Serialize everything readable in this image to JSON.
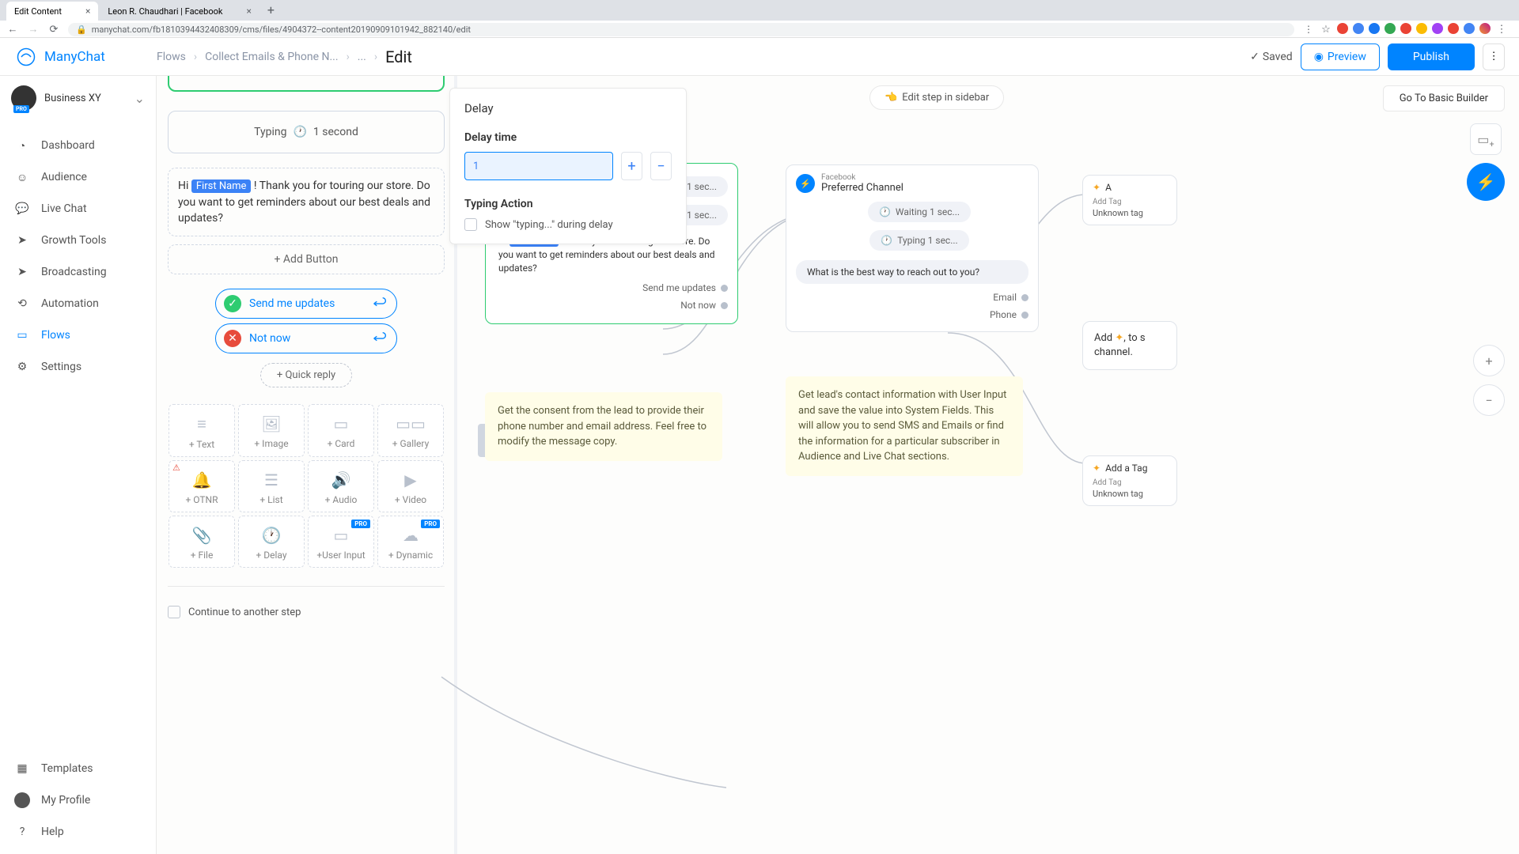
{
  "browser": {
    "tabs": [
      {
        "title": "Edit Content"
      },
      {
        "title": "Leon R. Chaudhari | Facebook"
      }
    ],
    "url": "manychat.com/fb181039443240830​9/cms/files/4904372--content201909091​01942_882140/edit"
  },
  "brand": {
    "name": "ManyChat"
  },
  "account": {
    "name": "Business XY",
    "badge": "PRO"
  },
  "nav": {
    "items": [
      {
        "label": "Dashboard"
      },
      {
        "label": "Audience"
      },
      {
        "label": "Live Chat"
      },
      {
        "label": "Growth Tools"
      },
      {
        "label": "Broadcasting"
      },
      {
        "label": "Automation"
      },
      {
        "label": "Flows",
        "active": true
      },
      {
        "label": "Settings"
      }
    ],
    "bottom": [
      {
        "label": "Templates"
      },
      {
        "label": "My Profile"
      },
      {
        "label": "Help"
      }
    ]
  },
  "breadcrumbs": {
    "a": "Flows",
    "b": "Collect Emails & Phone N...",
    "c": "...",
    "d": "Edit"
  },
  "header": {
    "saved": "Saved",
    "preview": "Preview",
    "publish": "Publish"
  },
  "canvas": {
    "edit_sidebar": "Edit step in sidebar",
    "basic": "Go To Basic Builder"
  },
  "editor": {
    "typing": {
      "label": "Typing",
      "duration": "1 second"
    },
    "message": {
      "pre": "Hi ",
      "tag": "First Name",
      "post": " ! Thank you for touring our store. Do you want to get reminders about our best deals and updates?"
    },
    "add_button": "+ Add Button",
    "btn_yes": "Send me updates",
    "btn_no": "Not now",
    "quick_reply": "+ Quick reply",
    "ctypes": [
      "+ Text",
      "+ Image",
      "+ Card",
      "+ Gallery",
      "+ OTNR",
      "+ List",
      "+ Audio",
      "+ Video",
      "+ File",
      "+ Delay",
      "+User Input",
      "+ Dynamic"
    ],
    "continue": "Continue to another step"
  },
  "popover": {
    "title": "Delay",
    "delay_time": "Delay time",
    "value": "1",
    "typing_action": "Typing Action",
    "show_typing": "Show \"typing...\" during delay"
  },
  "mcard1": {
    "wait1": "Waiting 1 sec...",
    "type1": "Typing 1 sec...",
    "pre": "Hi ",
    "tag": "First Name",
    "post": "! Thank you for touring our store. Do you want to get reminders about our best deals and updates?",
    "opt1": "Send me updates",
    "opt2": "Not now"
  },
  "note1": "Get the consent from the lead to provide their phone number and email address. Feel free to modify the message copy.",
  "pref": {
    "small": "Facebook",
    "title": "Preferred Channel",
    "wait": "Waiting 1 sec...",
    "type": "Typing 1 sec...",
    "q": "What is the best way to reach out to you?",
    "email": "Email",
    "phone": "Phone"
  },
  "note2": "Get lead's contact information with User Input and save the value into System Fields. This will allow you to send SMS and Emails or find the information for a particular subscriber in Audience and Live Chat sections.",
  "tagnote": {
    "pre": "Add ",
    "post": ", to s",
    "line2": "channel."
  },
  "tagcard": {
    "title": "A",
    "add": "Add Tag",
    "val": "Unknown tag",
    "full": "Add a Tag"
  }
}
